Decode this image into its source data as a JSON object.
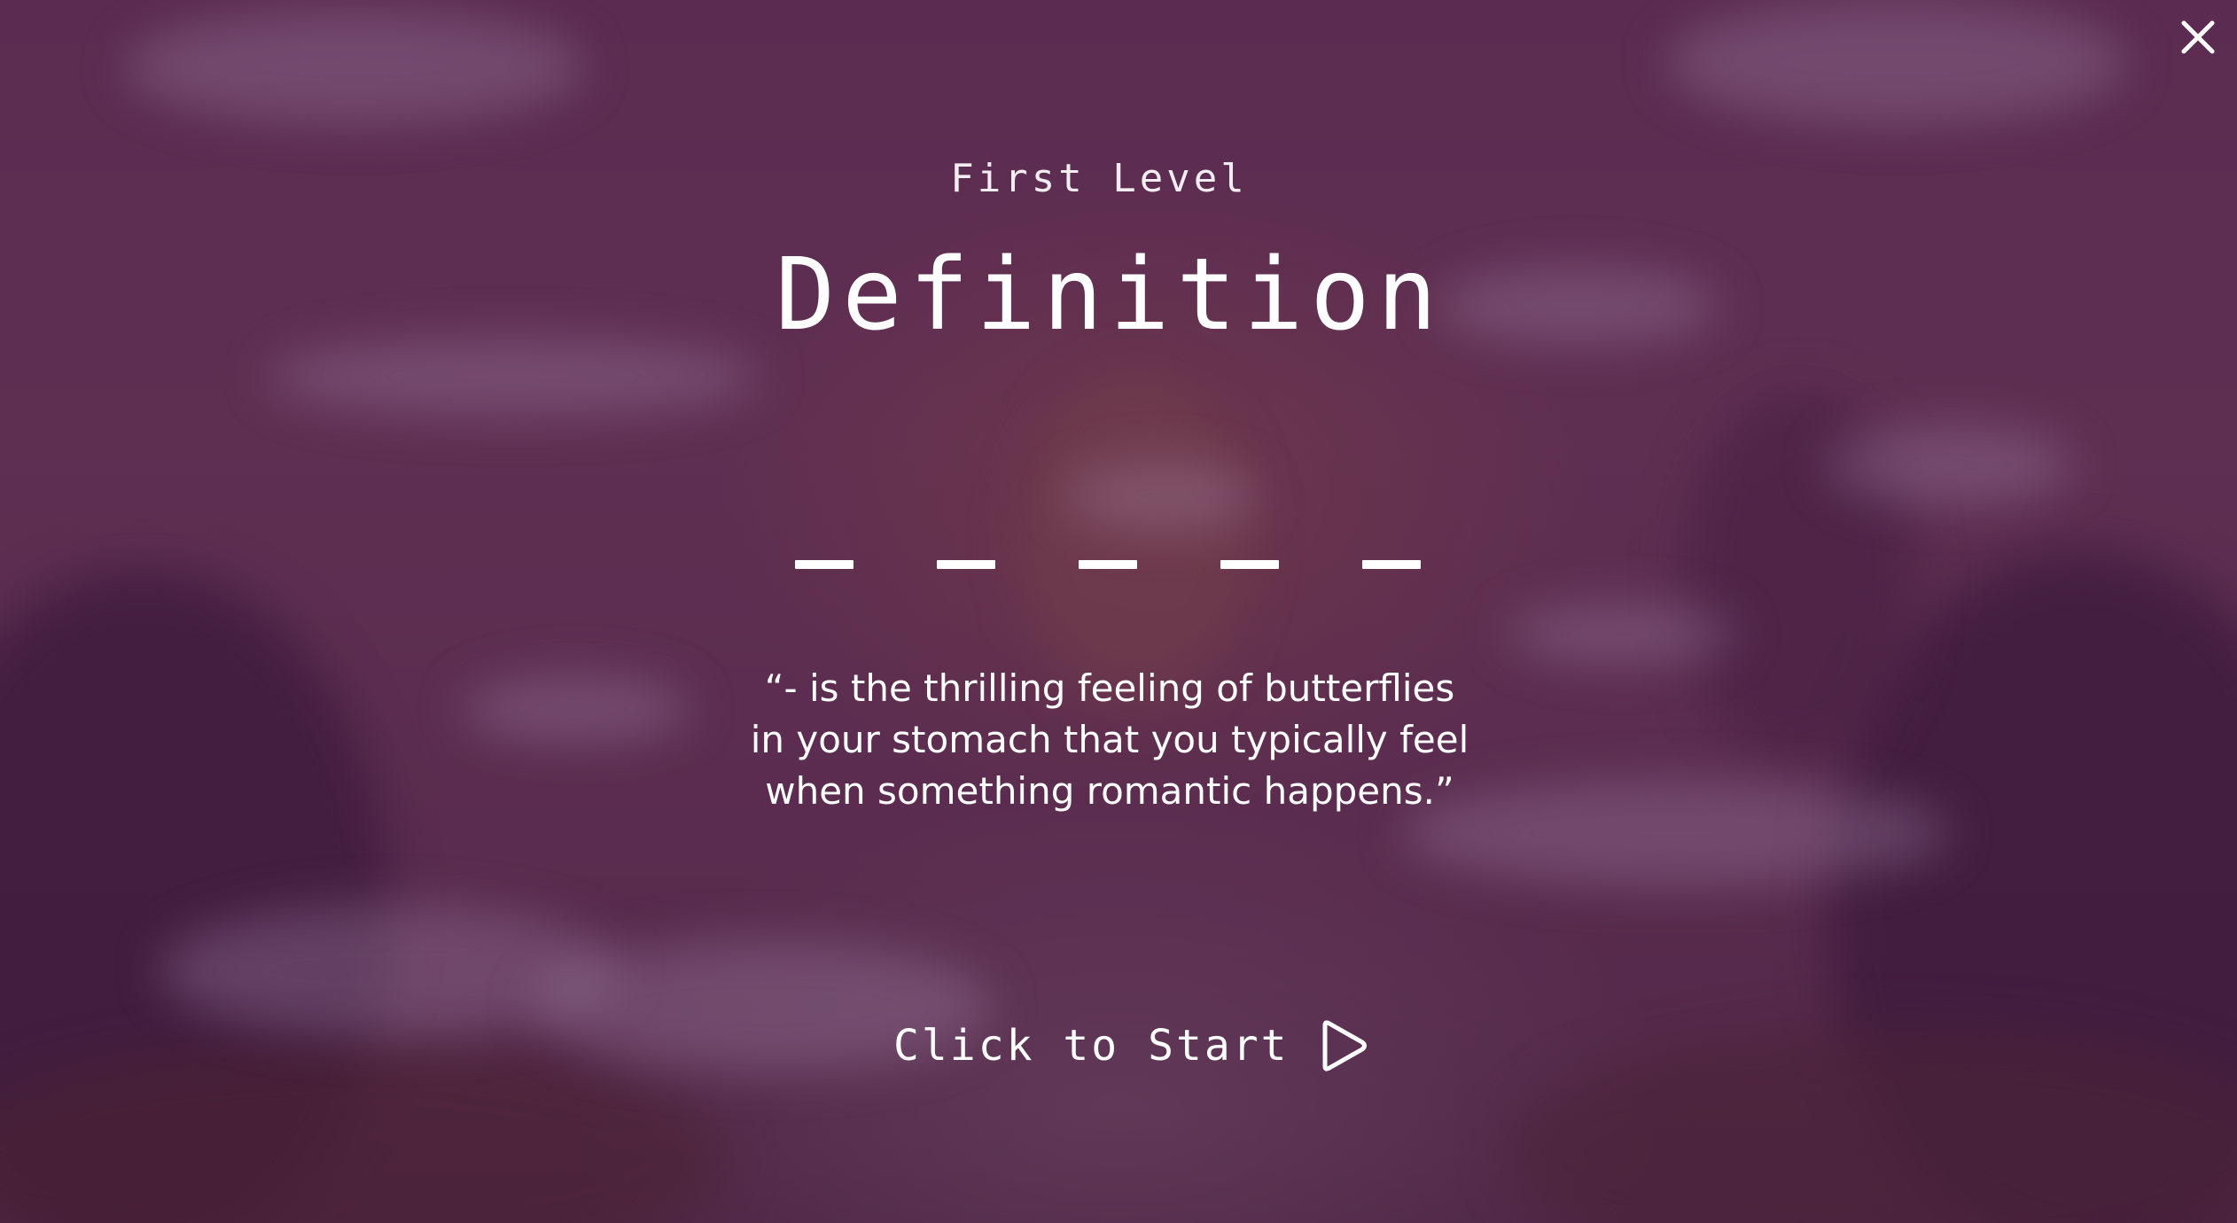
{
  "game": {
    "subtitle": "First Level",
    "title": "Definition",
    "answer_length": 5,
    "definition_lines": [
      "“- is the thrilling feeling of butterflies",
      "in your stomach that you typically feel",
      "when something romantic happens.”"
    ],
    "start_label": "Click to Start"
  },
  "icons": {
    "close": "close-icon",
    "play": "play-icon"
  },
  "colors": {
    "background": "#5a2d50",
    "text": "#ffffff"
  }
}
